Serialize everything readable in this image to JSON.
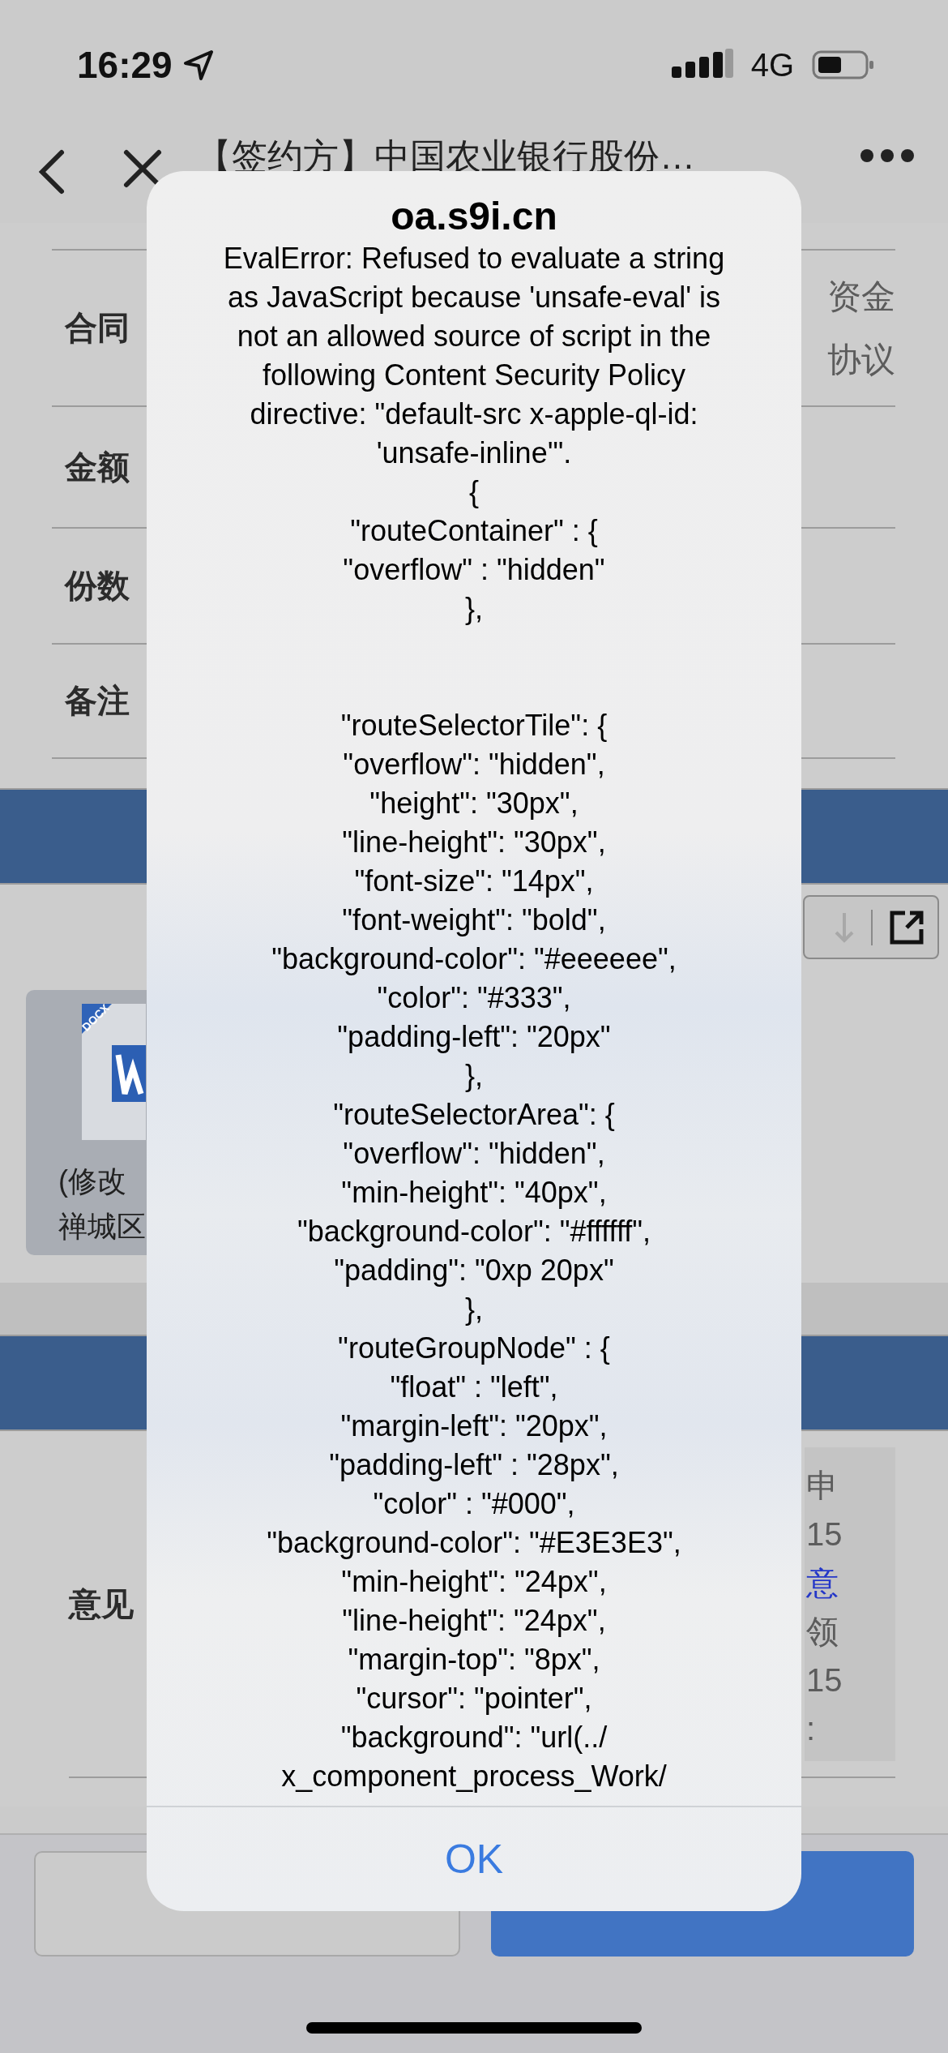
{
  "status_bar": {
    "time": "16:29",
    "network": "4G"
  },
  "nav": {
    "title": "【签约方】中国农业银行股份…"
  },
  "form": {
    "rows": [
      {
        "label": "合同",
        "value_lines": [
          "资金",
          "协议"
        ]
      },
      {
        "label": "金额"
      },
      {
        "label": "份数"
      },
      {
        "label": "备注"
      }
    ]
  },
  "attachments": {
    "file": {
      "badge": "DOCX",
      "name_lines": [
        "(修改",
        "禅城区"
      ]
    }
  },
  "opinion": {
    "label": "意见",
    "record_lines": [
      {
        "kind": "text",
        "text": "申"
      },
      {
        "kind": "text",
        "text": "15"
      },
      {
        "kind": "link",
        "text": "意"
      },
      {
        "kind": "text",
        "text": "领"
      },
      {
        "kind": "text",
        "text": "15"
      },
      {
        "kind": "text",
        "text": ":"
      }
    ]
  },
  "alert": {
    "title": "oa.s9i.cn",
    "message": "EvalError: Refused to evaluate a string\nas JavaScript because 'unsafe-eval' is\nnot an allowed source of script in the\nfollowing Content Security Policy\ndirective: \"default-src x-apple-ql-id:\n'unsafe-inline'\".\n{\n\"routeContainer\" : {\n\"overflow\" : \"hidden\"\n},\n\n\n\"routeSelectorTile\": {\n\"overflow\": \"hidden\",\n\"height\": \"30px\",\n\"line-height\": \"30px\",\n\"font-size\": \"14px\",\n\"font-weight\": \"bold\",\n\"background-color\": \"#eeeeee\",\n\"color\": \"#333\",\n\"padding-left\": \"20px\"\n},\n\"routeSelectorArea\": {\n\"overflow\": \"hidden\",\n\"min-height\": \"40px\",\n\"background-color\": \"#ffffff\",\n\"padding\": \"0xp 20px\"\n},\n\"routeGroupNode\" : {\n\"float\" : \"left\",\n\"margin-left\": \"20px\",\n\"padding-left\" : \"28px\",\n\"color\" : \"#000\",\n\"background-color\": \"#E3E3E3\",\n\"min-height\": \"24px\",\n\"line-height\": \"24px\",\n\"margin-top\": \"8px\",\n\"cursor\": \"pointer\",\n\"background\": \"url(../\nx_component_process_Work/",
    "button": "OK"
  }
}
